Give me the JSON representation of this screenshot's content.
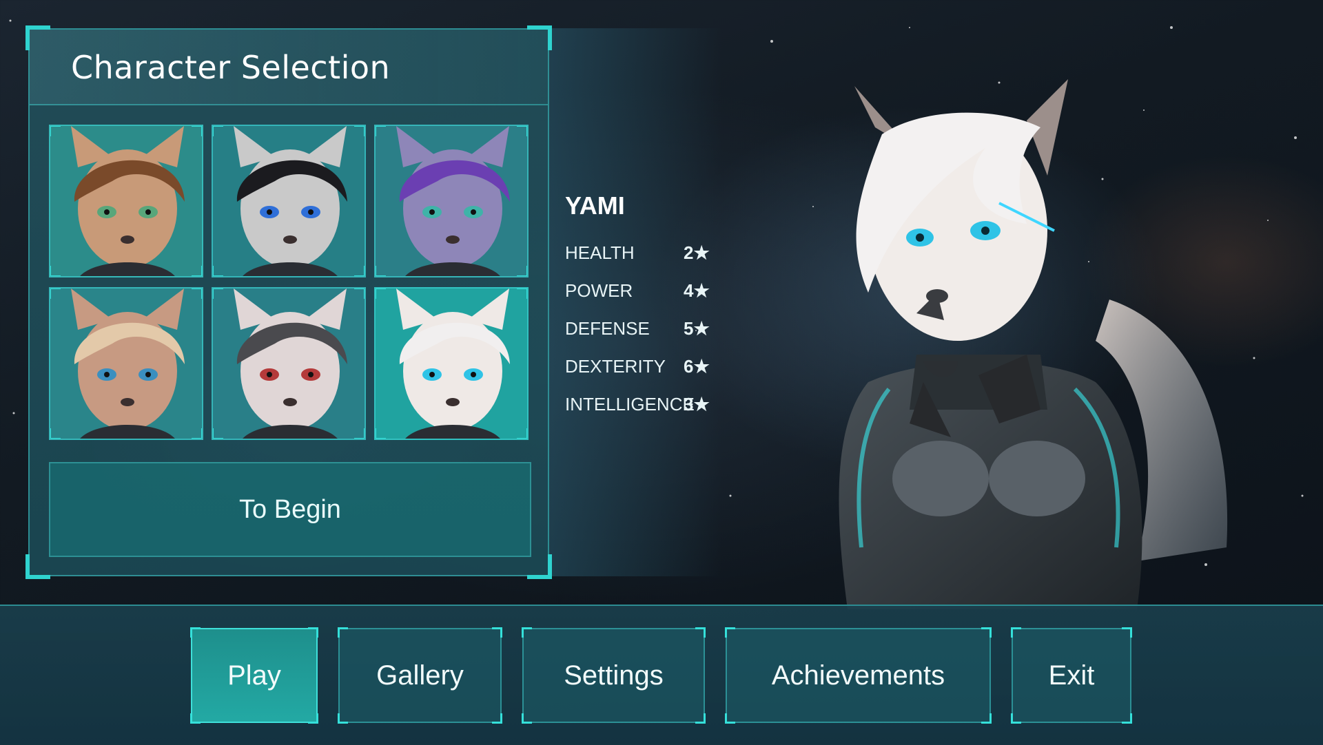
{
  "panel": {
    "title": "Character Selection",
    "begin_label": "To Begin",
    "portraits": [
      {
        "name": "portrait-1",
        "fur": "#c89a78",
        "hair": "#7a4a2a",
        "bg": "#2c8c8a",
        "eye": "#58a67a"
      },
      {
        "name": "portrait-2",
        "fur": "#c9c9c9",
        "hair": "#1b1b1f",
        "bg": "#267f86",
        "eye": "#2f6fd8"
      },
      {
        "name": "portrait-3",
        "fur": "#8e86b8",
        "hair": "#6b3fb2",
        "bg": "#2b7f88",
        "eye": "#3fb3a8"
      },
      {
        "name": "portrait-4",
        "fur": "#c79a82",
        "hair": "#e3c9a9",
        "bg": "#2a858a",
        "eye": "#3b8fbf"
      },
      {
        "name": "portrait-5",
        "fur": "#e0d6d6",
        "hair": "#4a4a4e",
        "bg": "#297f88",
        "eye": "#b43a3a"
      },
      {
        "name": "portrait-6",
        "fur": "#efe9e6",
        "hair": "#f1efef",
        "bg": "#20a3a0",
        "eye": "#2fc3e6",
        "selected": true
      }
    ]
  },
  "character": {
    "name": "YAMI",
    "stats": [
      {
        "label": "HEALTH",
        "value": "2★"
      },
      {
        "label": "POWER",
        "value": "4★"
      },
      {
        "label": "DEFENSE",
        "value": "5★"
      },
      {
        "label": "DEXTERITY",
        "value": "6★"
      },
      {
        "label": "INTELLIGENCE",
        "value": "3★"
      }
    ]
  },
  "nav": {
    "play": "Play",
    "gallery": "Gallery",
    "settings": "Settings",
    "achievements": "Achievements",
    "exit": "Exit"
  },
  "colors": {
    "accent": "#2fd3cf",
    "panel": "#1f5662",
    "active_button": "#23a9a4"
  }
}
